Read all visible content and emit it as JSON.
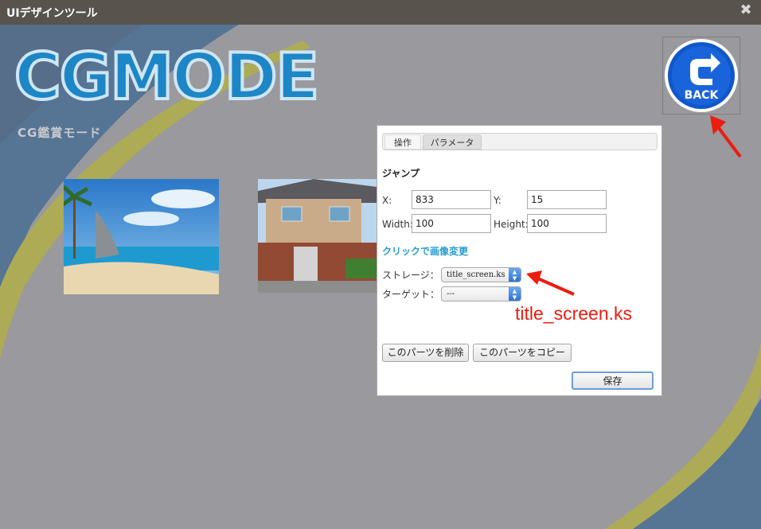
{
  "window": {
    "title": "UIデザインツール",
    "close_icon": "close-icon"
  },
  "background": {
    "logo": "CGMODE",
    "logo_sub": "CG鑑賞モード",
    "thumbnails": [
      "beach-thumbnail",
      "house-thumbnail"
    ],
    "back_button_label": "BACK"
  },
  "dialog": {
    "tabs": [
      {
        "label": "操作",
        "active": false
      },
      {
        "label": "パラメータ",
        "active": true
      }
    ],
    "section_title": "ジャンプ",
    "x_label": "X:",
    "x_value": "833",
    "y_label": "Y:",
    "y_value": "15",
    "width_label": "Width:",
    "width_value": "100",
    "height_label": "Height:",
    "height_value": "100",
    "image_link": "クリックで画像変更",
    "storage_label": "ストレージ：",
    "storage_value": "title_screen.ks",
    "target_label": "ターゲット：",
    "target_value": "---",
    "delete_button": "このパーツを削除",
    "copy_button": "このパーツをコピー",
    "save_button": "保存"
  },
  "annotation": {
    "text": "title_screen.ks",
    "color": "#ec1c0f"
  },
  "colors": {
    "accent_blue": "#1d86c6",
    "titlebar": "#58534c",
    "stripe_yellow": "#d8d500"
  }
}
